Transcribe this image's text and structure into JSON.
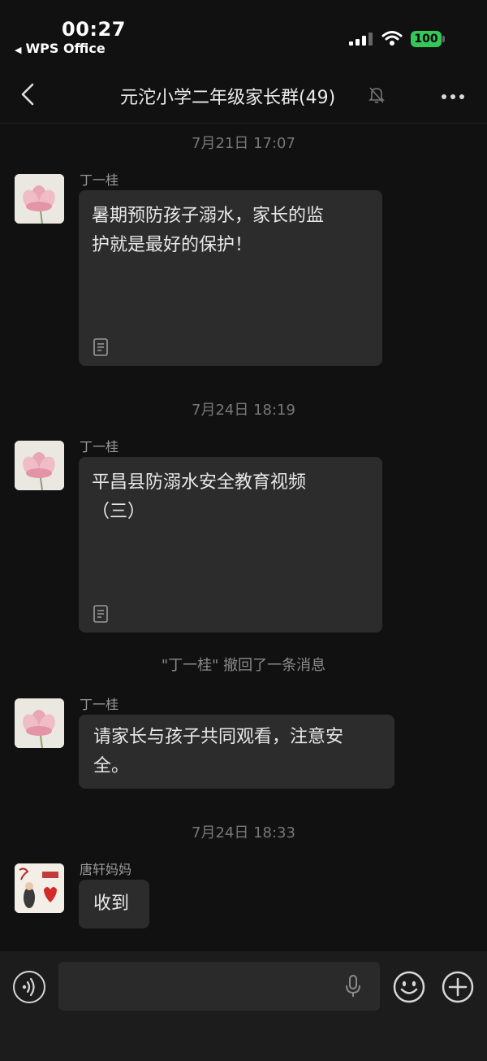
{
  "status_bar": {
    "time": "00:27",
    "back_app": "WPS Office",
    "battery": "100",
    "battery_color": "#34c759"
  },
  "header": {
    "title": "元沱小学二年级家长群(49)",
    "back_icon": "chevron-left-icon",
    "mute_icon": "bell-slash-icon",
    "more_icon": "more-dots-icon"
  },
  "messages": [
    {
      "type": "timestamp",
      "text": "7月21日 17:07"
    },
    {
      "type": "file",
      "sender": "丁一桂",
      "text": "暑期预防孩子溺水，家长的监护就是最好的保护！",
      "lines": [
        "暑期预防孩子溺水，家长的监",
        "护就是最好的保护！"
      ]
    },
    {
      "type": "timestamp",
      "text": "7月24日 18:19"
    },
    {
      "type": "file",
      "sender": "丁一桂",
      "text": "平昌县防溺水安全教育视频（三）",
      "lines": [
        "平昌县防溺水安全教育视频",
        "（三）"
      ]
    },
    {
      "type": "recall",
      "text": "\"丁一桂\" 撤回了一条消息"
    },
    {
      "type": "text",
      "sender": "丁一桂",
      "lines": [
        "请家长与孩子共同观看，注意安",
        "全。"
      ]
    },
    {
      "type": "timestamp",
      "text": "7月24日 18:33"
    },
    {
      "type": "text",
      "sender": "唐轩妈妈",
      "lines": [
        "收到"
      ]
    }
  ],
  "input_bar": {
    "voice_icon": "voice-icon",
    "mic_icon": "microphone-icon",
    "emoji_icon": "emoji-icon",
    "plus_icon": "plus-icon",
    "placeholder": ""
  }
}
